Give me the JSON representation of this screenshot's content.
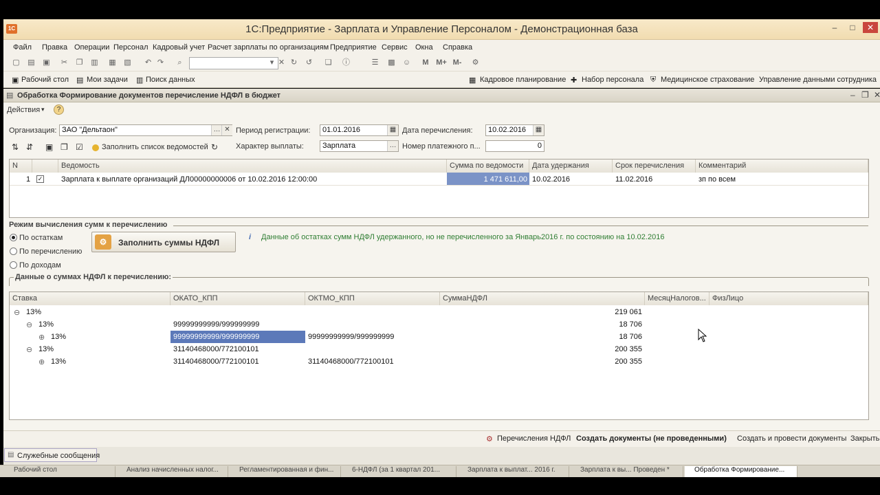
{
  "window": {
    "title": "1С:Предприятие - Зарплата и Управление Персоналом - Демонстрационная база",
    "app_icon": "1С"
  },
  "menu": [
    "Файл",
    "Правка",
    "Операции",
    "Персонал",
    "Кадровый учет",
    "Расчет зарплаты по организациям",
    "Предприятие",
    "Сервис",
    "Окна",
    "Справка"
  ],
  "toolbar2": {
    "left": [
      "Рабочий стол",
      "Мои задачи",
      "Поиск данных"
    ],
    "right": [
      "Кадровое планирование",
      "Набор персонала",
      "Медицинское страхование",
      "Управление данными сотрудника"
    ]
  },
  "form": {
    "title": "Обработка  Формирование документов перечисление НДФЛ в бюджет",
    "actions_label": "Действия",
    "help": "?",
    "org_label": "Организация:",
    "org_value": "ЗАО \"Дельтаон\"",
    "period_label": "Период регистрации:",
    "period_value": "01.01.2016",
    "date_label": "Дата перечисления:",
    "date_value": "10.02.2016",
    "fill_list_label": "Заполнить список ведомостей",
    "payout_label": "Характер выплаты:",
    "payout_value": "Зарплата",
    "payment_no_label": "Номер платежного п...",
    "payment_no_value": "0",
    "statements": {
      "headers": [
        "N",
        "",
        "Ведомость",
        "Сумма по ведомости",
        "Дата удержания",
        "Срок перечисления",
        "Комментарий"
      ],
      "rows": [
        {
          "n": "1",
          "checked": "✓",
          "name": "Зарплата к выплате организаций ДЛ00000000006 от 10.02.2016 12:00:00",
          "sum": "1 471 611,00",
          "date": "10.02.2016",
          "due": "11.02.2016",
          "comment": "зп по всем"
        }
      ]
    },
    "mode_title": "Режим вычисления сумм к перечислению",
    "modes": [
      "По остаткам",
      "По перечислению",
      "По доходам"
    ],
    "fill_button": "Заполнить суммы НДФЛ",
    "info_text": "Данные об остатках сумм НДФЛ удержанного, но не перечисленного за Январь2016 г. по состоянию на 10.02.2016",
    "sums_title": "Данные о суммах НДФЛ к перечислению:",
    "tree": {
      "headers": [
        "Ставка",
        "ОКАТО_КПП",
        "ОКТМО_КПП",
        "СуммаНДФЛ",
        "МесяцНалогов...",
        "ФизЛицо"
      ],
      "rows": [
        {
          "toggle": "⊖",
          "rate": "13%",
          "okato": "",
          "oktmo": "",
          "sum": "219 061"
        },
        {
          "toggle": "⊖",
          "rate": "13%",
          "okato": "99999999999/999999999",
          "oktmo": "",
          "sum": "18 706"
        },
        {
          "toggle": "⊕",
          "rate": "13%",
          "okato": "99999999999/999999999",
          "oktmo": "99999999999/999999999",
          "sum": "18 706"
        },
        {
          "toggle": "⊖",
          "rate": "13%",
          "okato": "31140468000/772100101",
          "oktmo": "",
          "sum": "200 355"
        },
        {
          "toggle": "⊕",
          "rate": "13%",
          "okato": "31140468000/772100101",
          "oktmo": "31140468000/772100101",
          "sum": "200 355"
        }
      ]
    }
  },
  "status": {
    "transfers": "Перечисления НДФЛ",
    "create": "Создать документы (не проведенными)",
    "create_post": "Создать и провести документы",
    "close": "Закрыть"
  },
  "messages_tab": "Служебные сообщения",
  "tasks": [
    "Рабочий стол",
    "Анализ начисленных налог...",
    "Регламентированная и фин...",
    "6-НДФЛ (за 1 квартал 201...",
    "Зарплата к выплат... 2016 г.",
    "Зарплата к вы... Проведен *",
    "Обработка  Формирование..."
  ]
}
